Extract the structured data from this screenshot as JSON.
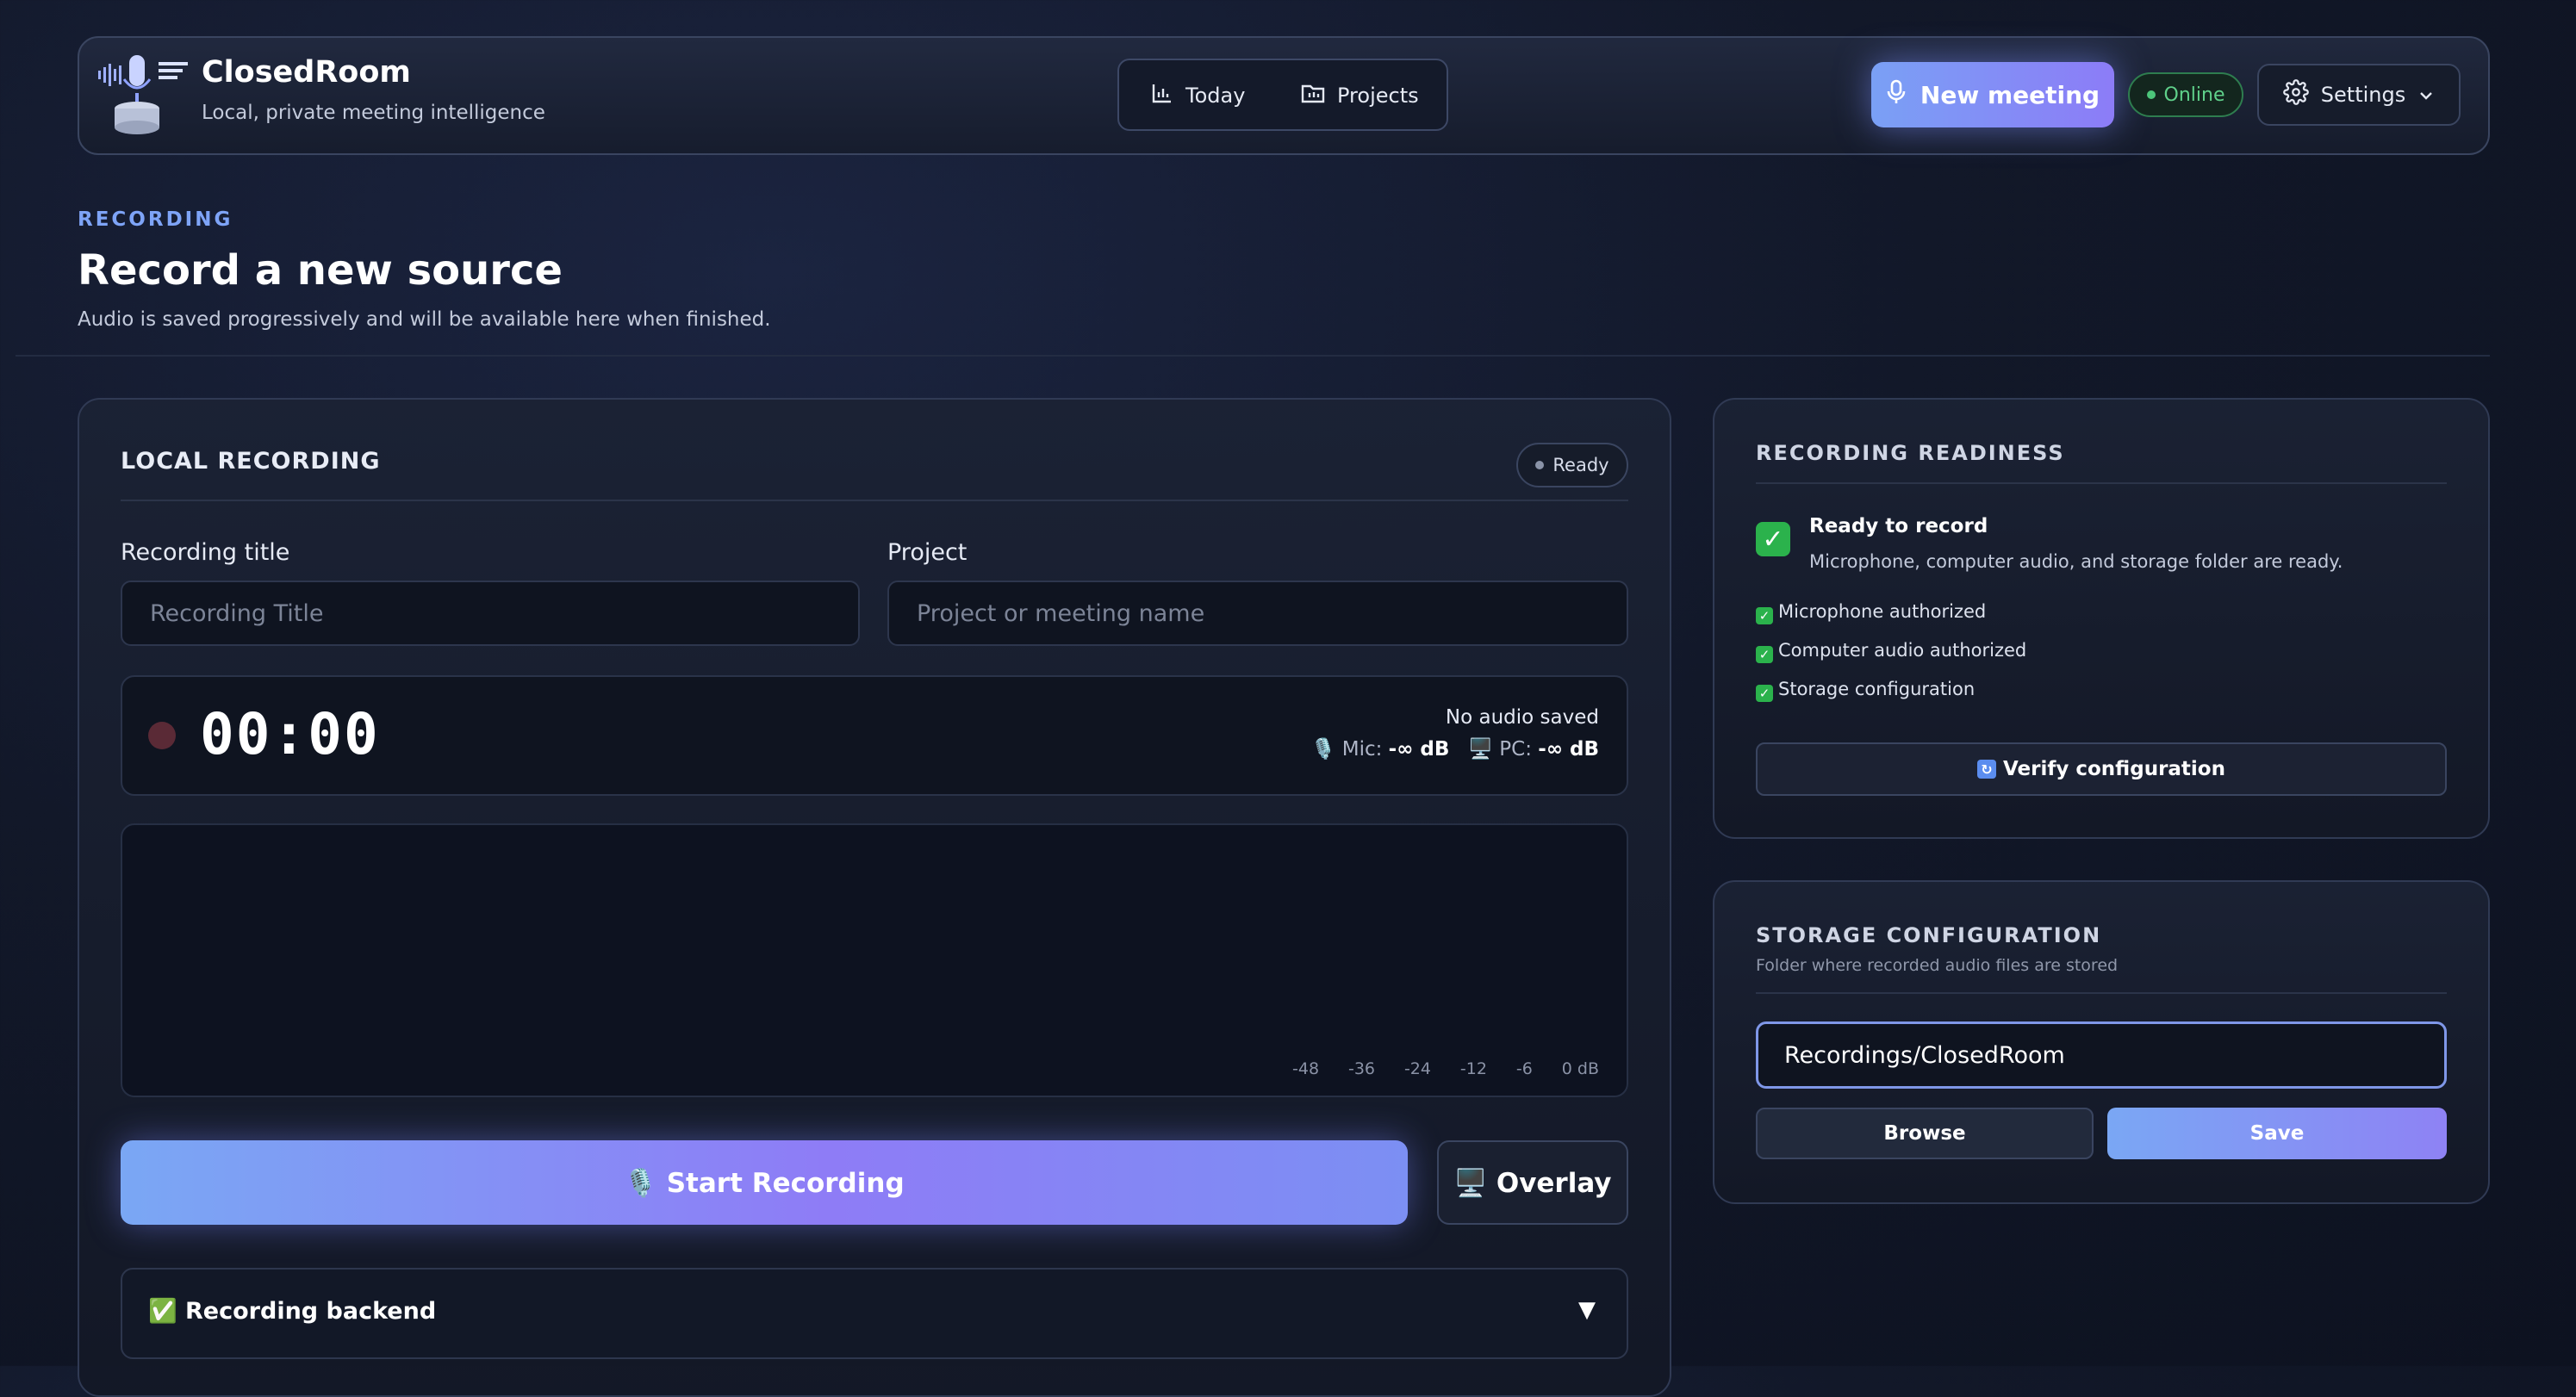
{
  "app": {
    "name": "ClosedRoom",
    "tagline": "Local, private meeting intelligence"
  },
  "nav": {
    "today": "Today",
    "projects": "Projects"
  },
  "header": {
    "new_meeting": "New meeting",
    "status": "Online",
    "settings": "Settings"
  },
  "page": {
    "eyebrow": "RECORDING",
    "title": "Record a new source",
    "description": "Audio is saved progressively and will be available here when finished."
  },
  "local_recording": {
    "title": "LOCAL RECORDING",
    "status": "Ready",
    "title_label": "Recording title",
    "title_placeholder": "Recording Title",
    "project_label": "Project",
    "project_placeholder": "Project or meeting name",
    "timer": "00:00",
    "saved_status": "No audio saved",
    "mic_label": "🎙️ Mic:",
    "mic_level": "-∞ dB",
    "pc_label": "🖥️ PC:",
    "pc_level": "-∞ dB",
    "scale": [
      "-48",
      "-36",
      "-24",
      "-12",
      "-6",
      "0 dB"
    ],
    "start_button": "🎙️ Start Recording",
    "overlay_button": "🖥️ Overlay",
    "backend_label": "✅ Recording backend",
    "backend_toggle": "▼"
  },
  "readiness": {
    "title": "RECORDING READINESS",
    "ready_title": "Ready to record",
    "ready_desc": "Microphone, computer audio, and storage folder are ready.",
    "checks": [
      "Microphone authorized",
      "Computer audio authorized",
      "Storage configuration"
    ],
    "verify_button": "Verify configuration"
  },
  "storage": {
    "title": "STORAGE CONFIGURATION",
    "subtitle": "Folder where recorded audio files are stored",
    "path": "Recordings/ClosedRoom",
    "browse": "Browse",
    "save": "Save"
  },
  "colors": {
    "accent_start": "#7aa7f4",
    "accent_end": "#8e7cf6",
    "online": "#4cc57a",
    "check": "#2bb24c"
  }
}
